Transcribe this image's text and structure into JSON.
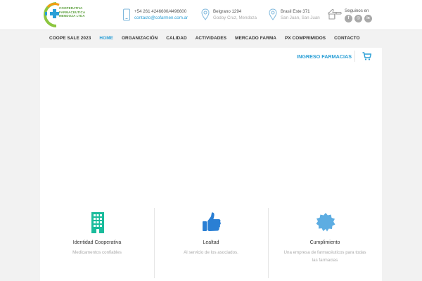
{
  "logo": {
    "lines": [
      "COOPERATIVA",
      "FARMACEUTICA",
      "MENDOZA LTDA"
    ],
    "colors": {
      "green": "#8cc63f",
      "orange": "#f39c12",
      "blue": "#2a9fd6"
    }
  },
  "contacts": [
    {
      "icon": "phone-icon",
      "line1": "+54 261 4246600/4496600",
      "line2": "contacto@cofarmen.com.ar"
    },
    {
      "icon": "map-pin-icon",
      "line1": "Belgrano 1294",
      "line2": "Godoy Cruz, Mendoza"
    },
    {
      "icon": "map-pin-icon",
      "line1": "Brasil Este 371",
      "line2": "San Juan, San Juan"
    }
  ],
  "social": {
    "title": "Seguinos en",
    "icons": [
      {
        "name": "facebook-icon",
        "glyph": "f"
      },
      {
        "name": "instagram-icon",
        "glyph": "◎"
      },
      {
        "name": "linkedin-icon",
        "glyph": "in"
      }
    ]
  },
  "nav": {
    "items": [
      "COOPE SALE 2023",
      "HOME",
      "ORGANIZACIÓN",
      "CALIDAD",
      "ACTIVIDADES",
      "MERCADO FARMA",
      "PX COMPRIMIDOS",
      "CONTACTO"
    ],
    "active_index": 1
  },
  "main": {
    "ingreso_label": "INGRESO FARMACIAS"
  },
  "features": [
    {
      "icon": "building-icon",
      "title": "Identidad Cooperativa",
      "desc": "Medicamentos confiables",
      "color": "#1abc9c"
    },
    {
      "icon": "thumbs-up-icon",
      "title": "Lealtad",
      "desc": "Al servicio de los asociados.",
      "color": "#2a7fd4"
    },
    {
      "icon": "certificate-icon",
      "title": "Cumplimiento",
      "desc": "Una empresa de farmacéuticos para todas las farmacias",
      "color": "#5dade2"
    }
  ],
  "colors": {
    "accent": "#2a9fd6",
    "nav_text": "#333333",
    "muted": "#aaaaaa"
  }
}
